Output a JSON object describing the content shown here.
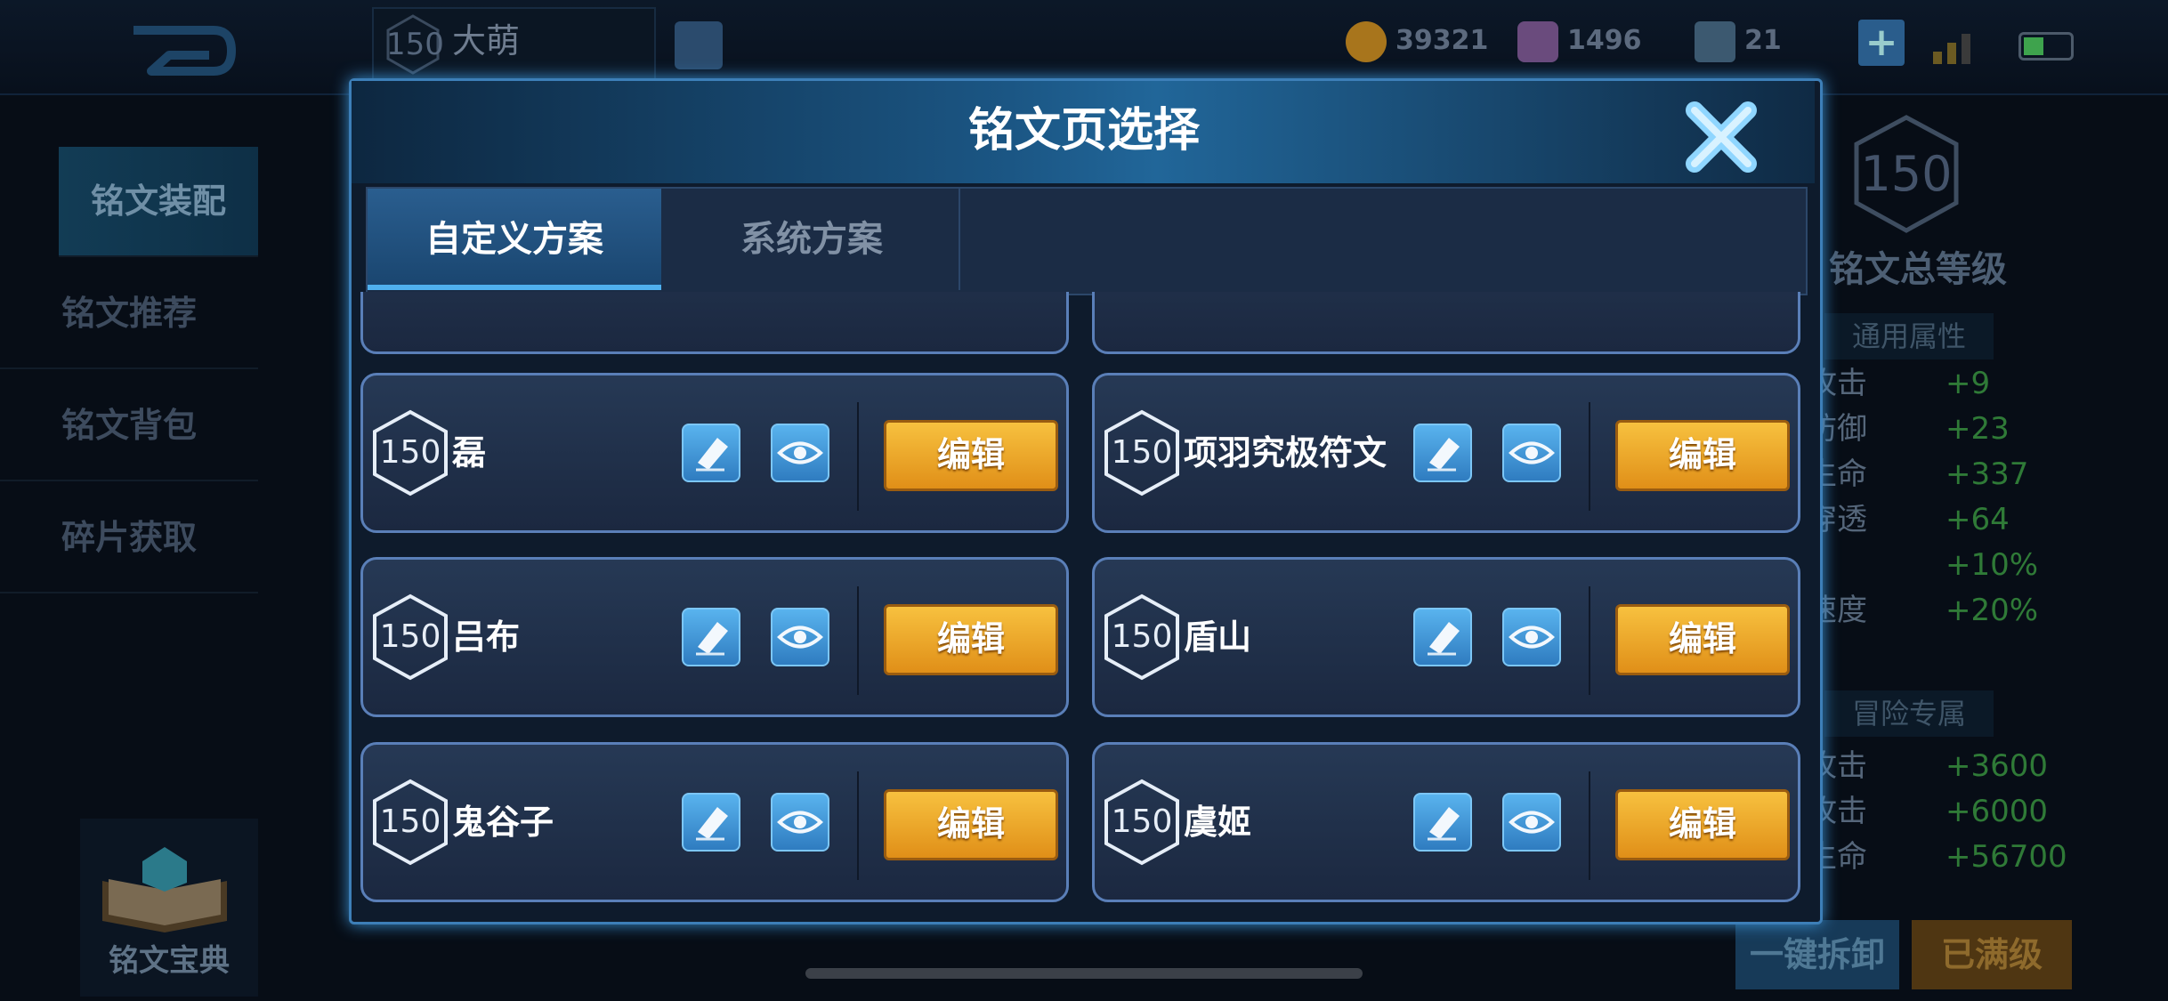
{
  "header": {
    "player_level": "150",
    "player_name": "大萌",
    "gold": "39321",
    "diamonds": "1496",
    "coupons": "21",
    "plus_label": "+"
  },
  "sidebar": {
    "items": [
      {
        "label": "铭文装配",
        "active": true
      },
      {
        "label": "铭文推荐",
        "active": false
      },
      {
        "label": "铭文背包",
        "active": false
      },
      {
        "label": "碎片获取",
        "active": false
      }
    ],
    "codex_label": "铭文宝典"
  },
  "right_panel": {
    "total_level": "150",
    "total_level_label": "铭文总等级",
    "general_title": "通用属性",
    "general_stats": [
      {
        "key": "攻击",
        "value": "+9"
      },
      {
        "key": "防御",
        "value": "+23"
      },
      {
        "key": "生命",
        "value": "+337"
      },
      {
        "key": "穿透",
        "value": "+64"
      },
      {
        "key": "",
        "value": "+10%"
      },
      {
        "key": "速度",
        "value": "+20%"
      }
    ],
    "adventure_title": "冒险专属",
    "adventure_stats": [
      {
        "key": "攻击",
        "value": "+3600"
      },
      {
        "key": "攻击",
        "value": "+6000"
      },
      {
        "key": "生命",
        "value": "+56700"
      }
    ],
    "dismantle_label": "一键拆卸",
    "maxed_label": "已满级"
  },
  "modal": {
    "title": "铭文页选择",
    "tabs": [
      {
        "label": "自定义方案",
        "active": true
      },
      {
        "label": "系统方案",
        "active": false
      }
    ],
    "pages": [
      {
        "level": "150",
        "name": "磊",
        "edit_label": "编辑"
      },
      {
        "level": "150",
        "name": "项羽究极符文",
        "edit_label": "编辑"
      },
      {
        "level": "150",
        "name": "吕布",
        "edit_label": "编辑"
      },
      {
        "level": "150",
        "name": "盾山",
        "edit_label": "编辑"
      },
      {
        "level": "150",
        "name": "鬼谷子",
        "edit_label": "编辑"
      },
      {
        "level": "150",
        "name": "虞姬",
        "edit_label": "编辑"
      }
    ]
  },
  "colors": {
    "accent_blue": "#3d7fb8",
    "edit_gold": "#f0a92a",
    "stat_green": "#2f7a37"
  },
  "icons": [
    "back-icon",
    "level-hex-icon",
    "pencil-icon",
    "eye-icon",
    "close-icon",
    "gold-coin-icon",
    "diamond-icon",
    "coupon-icon",
    "plus-icon",
    "signal-icon",
    "battery-icon",
    "codex-book-icon"
  ]
}
